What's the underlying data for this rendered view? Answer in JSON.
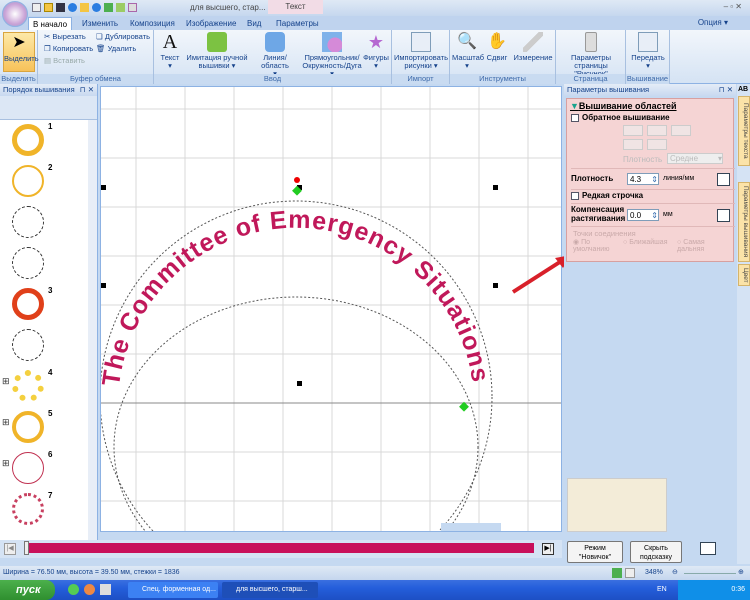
{
  "window": {
    "title": "для высшего, стар...",
    "context_tab": "Текст",
    "options": "Опция"
  },
  "tabs": [
    "В начало",
    "Изменить",
    "Композиция",
    "Изображение",
    "Вид",
    "Параметры"
  ],
  "ribbon": {
    "select": {
      "label": "Выделить",
      "group": "Выделить"
    },
    "clipboard": {
      "cut": "Вырезать",
      "copy": "Копировать",
      "paste": "Вставить",
      "duplicate": "Дублировать",
      "delete": "Удалить",
      "group": "Буфер обмена"
    },
    "input": {
      "text": "Текст",
      "hand": "Имитация ручной вышивки",
      "line": "Линия/область",
      "rect": "Прямоугольник/ Окружность/Дуга",
      "shapes": "Фигуры",
      "group": "Ввод"
    },
    "import": {
      "import": "Импортировать рисунки",
      "group": "Импорт"
    },
    "tools": {
      "zoom": "Масштаб",
      "pan": "Сдвиг",
      "measure": "Измерение",
      "group": "Инструменты"
    },
    "page": {
      "params": "Параметры страницы \"Рисунок\"",
      "group": "Страница \"Рисунок\""
    },
    "embroidery": {
      "send": "Передать",
      "group": "Вышивание"
    }
  },
  "left_panel": {
    "title": "Порядок вышивания",
    "items": [
      {
        "label": "1"
      },
      {
        "label": "2"
      },
      {
        "label": ""
      },
      {
        "label": ""
      },
      {
        "label": "3"
      },
      {
        "label": ""
      },
      {
        "label": "4"
      },
      {
        "label": "5"
      },
      {
        "label": "6"
      },
      {
        "label": "7"
      }
    ]
  },
  "canvas": {
    "curved_text": "The Committee of Emergency Situations"
  },
  "right_panel": {
    "title": "Параметры вышивания",
    "section": "Вышивание областей",
    "reverse": "Обратное вышивание",
    "density_label_small": "Плотность",
    "density_select": "Средне",
    "density": "Плотность",
    "density_value": "4.3",
    "density_unit": "линия/мм",
    "sparse": "Редкая строчка",
    "compensation": "Компенсация растягивания",
    "compensation_value": "0.0",
    "compensation_unit": "мм",
    "join_points": "Точки соединения",
    "join_options": [
      "По умолчанию",
      "Ближайшая",
      "Самая дальняя"
    ]
  },
  "side_tabs": [
    "Параметры текста",
    "Параметры вышивания",
    "Цвет"
  ],
  "buttons": {
    "novice": "Режим \"Новичок\"",
    "hide_hint": "Скрыть подсказку"
  },
  "status": {
    "text": "Ширина = 76.50 мм, высота = 39.50 мм, стежки = 1836",
    "zoom": "348%"
  },
  "taskbar": {
    "start": "пуск",
    "tasks": [
      "Спец. форменная од...",
      "для высшего, старш..."
    ],
    "lang": "EN",
    "time": "0:36"
  },
  "colors": {
    "timeline": "#c8105a",
    "text_stitch": "#c0185a",
    "panel": "#f5d4d4"
  }
}
